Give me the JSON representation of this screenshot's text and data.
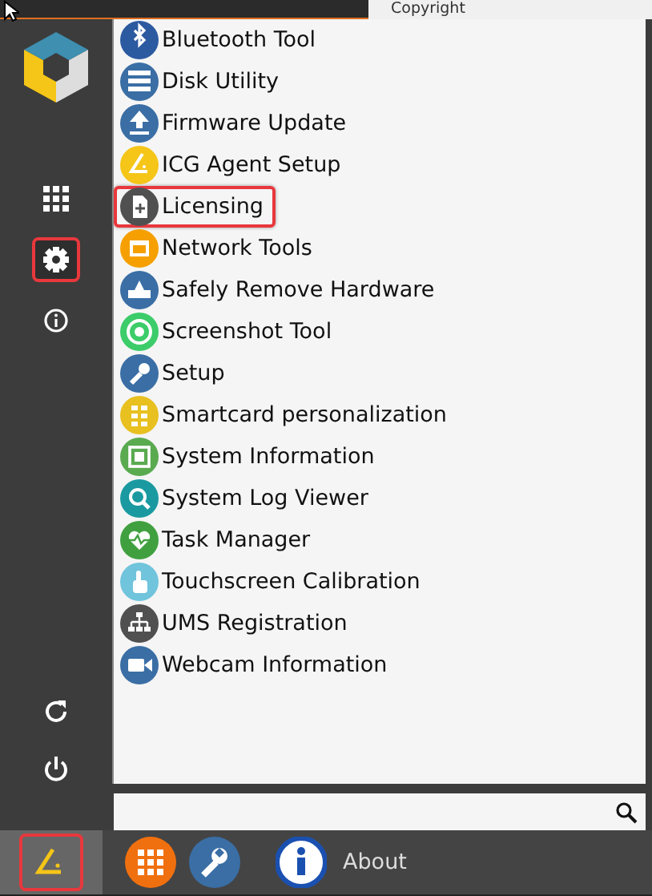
{
  "background_window": {
    "text": "Copyright"
  },
  "sidebar": {
    "buttons": [
      {
        "kind": "apps",
        "highlighted": false
      },
      {
        "kind": "settings",
        "highlighted": true
      },
      {
        "kind": "info",
        "highlighted": false
      },
      {
        "kind": "restart",
        "highlighted": false
      },
      {
        "kind": "power",
        "highlighted": false
      }
    ]
  },
  "menu": {
    "items": [
      {
        "label": "Bluetooth Tool",
        "color": "#2c5aa0",
        "highlighted": false
      },
      {
        "label": "Disk Utility",
        "color": "#3a6ea5",
        "highlighted": false
      },
      {
        "label": "Firmware Update",
        "color": "#3a6ea5",
        "highlighted": false
      },
      {
        "label": "ICG Agent Setup",
        "color": "#f5c518",
        "highlighted": false
      },
      {
        "label": "Licensing",
        "color": "#505050",
        "highlighted": true
      },
      {
        "label": "Network Tools",
        "color": "#f5a000",
        "highlighted": false
      },
      {
        "label": "Safely Remove Hardware",
        "color": "#3a6ea5",
        "highlighted": false
      },
      {
        "label": "Screenshot Tool",
        "color": "#3ccc6a",
        "highlighted": false
      },
      {
        "label": "Setup",
        "color": "#3a6ea5",
        "highlighted": false
      },
      {
        "label": "Smartcard personalization",
        "color": "#e8c020",
        "highlighted": false
      },
      {
        "label": "System Information",
        "color": "#5aaa50",
        "highlighted": false
      },
      {
        "label": "System Log Viewer",
        "color": "#1a9aa0",
        "highlighted": false
      },
      {
        "label": "Task Manager",
        "color": "#40a040",
        "highlighted": false
      },
      {
        "label": "Touchscreen Calibration",
        "color": "#70c4dc",
        "highlighted": false
      },
      {
        "label": "UMS Registration",
        "color": "#505050",
        "highlighted": false
      },
      {
        "label": "Webcam Information",
        "color": "#3a6ea5",
        "highlighted": false
      }
    ]
  },
  "taskbar": {
    "start_highlighted": true,
    "about_label": "About"
  }
}
